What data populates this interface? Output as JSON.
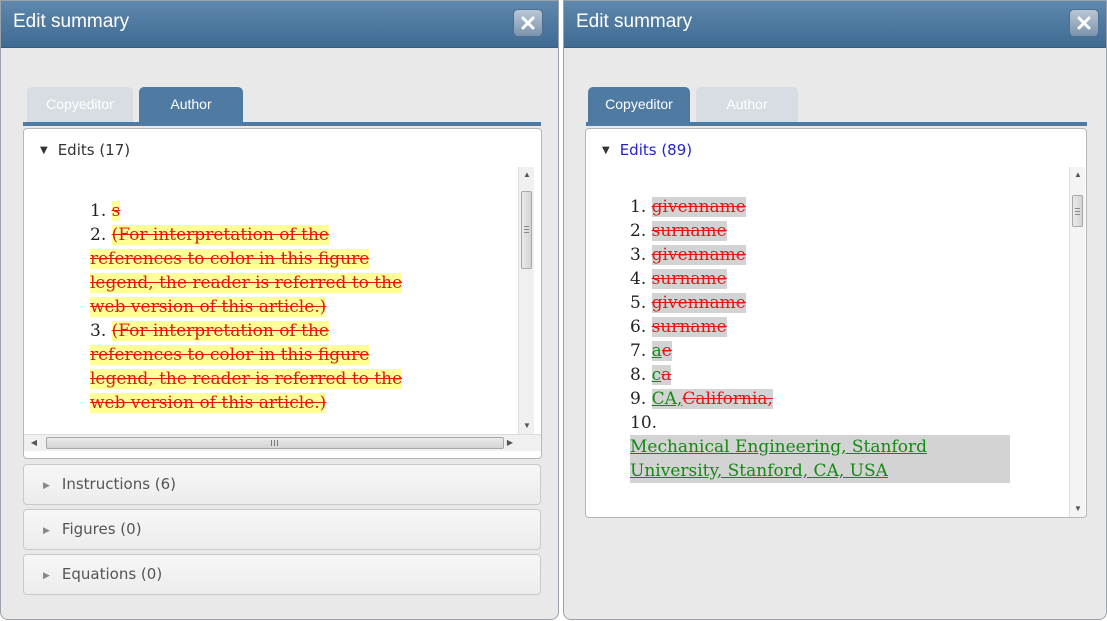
{
  "left_dialog": {
    "title": "Edit summary",
    "tabs": [
      {
        "label": "Copyeditor",
        "active": false
      },
      {
        "label": "Author",
        "active": true
      }
    ],
    "edits_header": "Edits (17)",
    "edits": [
      {
        "num": "1.",
        "lines": [
          "s"
        ]
      },
      {
        "num": "2.",
        "lines": [
          "(For interpretation of the",
          "references to color in this figure",
          "legend, the reader is referred to the",
          "web version of this article.)"
        ]
      },
      {
        "num": "3.",
        "lines": [
          "(For interpretation of the",
          "references to color in this figure",
          "legend, the reader is referred to the",
          "web version of this article.)"
        ]
      }
    ],
    "sections": [
      {
        "label": "Instructions (6)"
      },
      {
        "label": "Figures (0)"
      },
      {
        "label": "Equations (0)"
      }
    ]
  },
  "right_dialog": {
    "title": "Edit summary",
    "tabs": [
      {
        "label": "Copyeditor",
        "active": true
      },
      {
        "label": "Author",
        "active": false
      }
    ],
    "edits_header": "Edits (89)",
    "edits": [
      {
        "num": "1.",
        "deleted": "givenname"
      },
      {
        "num": "2.",
        "deleted": "surname"
      },
      {
        "num": "3.",
        "deleted": "givenname"
      },
      {
        "num": "4.",
        "deleted": "surname"
      },
      {
        "num": "5.",
        "deleted": "givenname"
      },
      {
        "num": "6.",
        "deleted": "surname"
      },
      {
        "num": "7.",
        "inserted": "a",
        "deleted": "e"
      },
      {
        "num": "8.",
        "inserted": "c",
        "deleted": "a"
      },
      {
        "num": "9.",
        "inserted": "CA,",
        "deleted": "California,"
      },
      {
        "num": "10.",
        "inserted_lines": [
          "Mechanical Engineering, Stanford",
          "University, Stanford, CA, USA"
        ]
      }
    ]
  },
  "colors": {
    "titlebar": "#4f7aa1",
    "deleted_text": "#e01818",
    "inserted_text": "#128a12",
    "highlight_author": "#ffff99",
    "highlight_copyeditor": "#d3d3d3",
    "link_header": "#2323c8"
  },
  "icons": {
    "close": "close-x-icon",
    "expanded": "triangle-down-icon",
    "collapsed": "triangle-right-icon"
  }
}
